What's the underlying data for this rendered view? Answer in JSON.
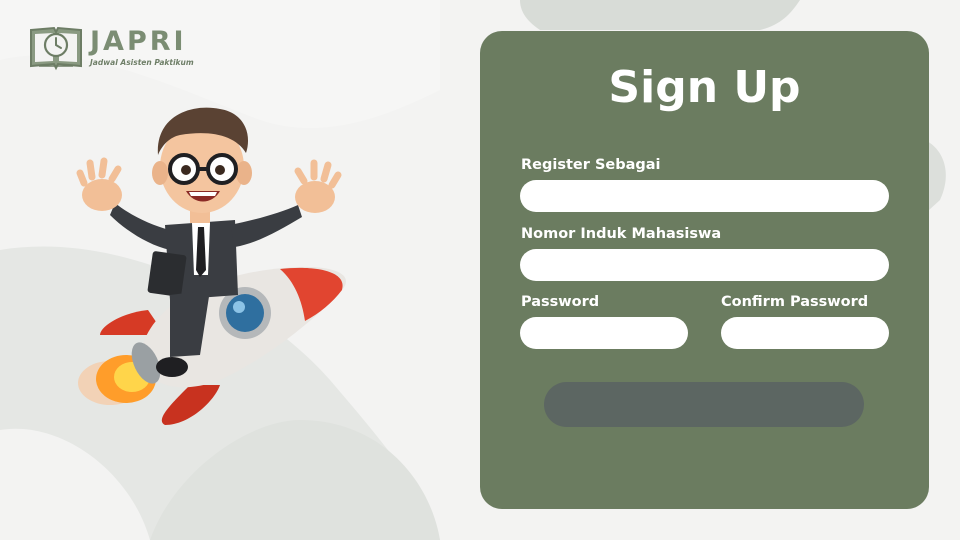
{
  "brand": {
    "name": "JAPRI",
    "tagline": "Jadwal Asisten Paktikum"
  },
  "form": {
    "title": "Sign Up",
    "fields": {
      "register_as": {
        "label": "Register Sebagai",
        "value": "",
        "placeholder": ""
      },
      "student_id": {
        "label": "Nomor Induk Mahasiswa",
        "value": "",
        "placeholder": ""
      },
      "password": {
        "label": "Password",
        "value": "",
        "placeholder": ""
      },
      "confirm_password": {
        "label": "Confirm Password",
        "value": "",
        "placeholder": ""
      }
    },
    "submit_label": ""
  },
  "colors": {
    "card": "#6b7c60",
    "submit": "#5c6662",
    "brand": "#7b8d73"
  },
  "icons": [
    "book-clock-logo-icon"
  ]
}
